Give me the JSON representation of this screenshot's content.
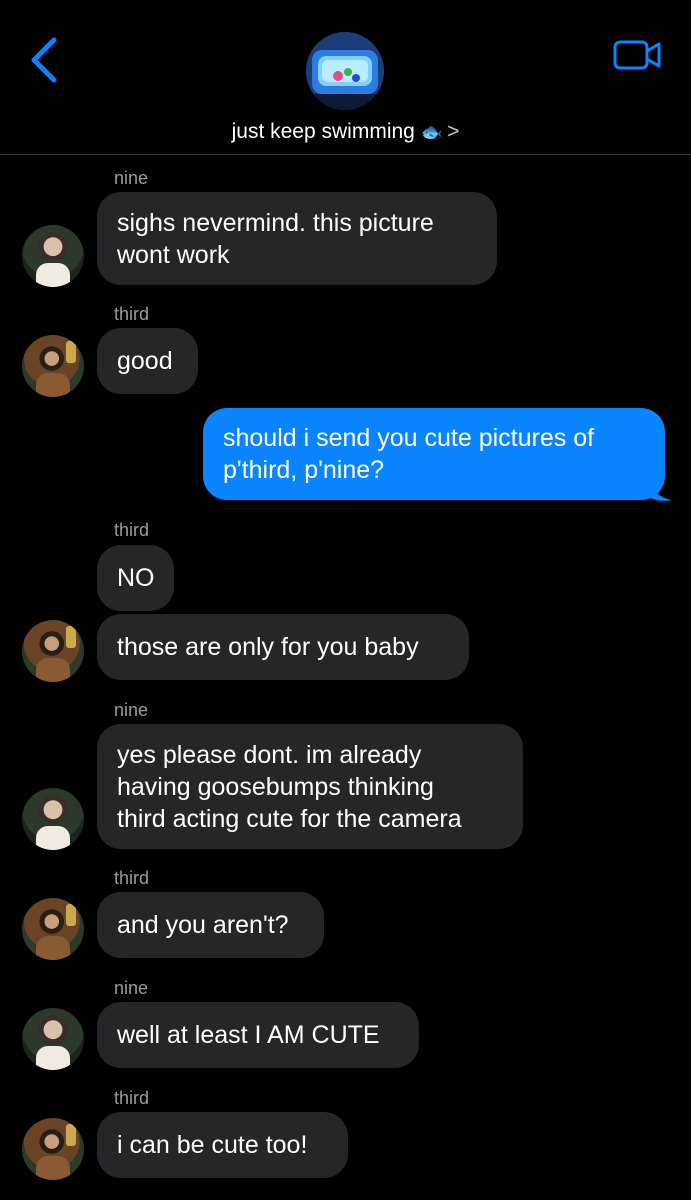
{
  "header": {
    "back_icon": "chevron-left-icon",
    "group_name": "just keep swimming",
    "group_emoji": "🐟",
    "chevron": ">",
    "video_icon": "video-camera-icon"
  },
  "colors": {
    "accent": "#0a84ff",
    "incoming_bubble": "#262628",
    "sender_label": "#9b9ba1",
    "background": "#000000"
  },
  "messages": [
    {
      "sender": "nine",
      "text_lines": [
        "sighs nevermind. this picture",
        "wont work"
      ]
    },
    {
      "sender": "third",
      "text_lines": [
        "good"
      ]
    },
    {
      "sender": "me",
      "text_lines": [
        "should i send you cute pictures of",
        "p'third, p'nine?"
      ]
    },
    {
      "sender": "third",
      "text_lines": [
        "NO"
      ]
    },
    {
      "sender": "",
      "text_lines": [
        "those are only for you baby"
      ]
    },
    {
      "sender": "nine",
      "text_lines": [
        "yes please dont. im already",
        "having goosebumps thinking",
        "third acting cute for the camera"
      ]
    },
    {
      "sender": "third",
      "text_lines": [
        "and you aren't?"
      ]
    },
    {
      "sender": "nine",
      "text_lines": [
        "well at least I AM CUTE"
      ]
    },
    {
      "sender": "third",
      "text_lines": [
        "i can be cute too!"
      ]
    }
  ]
}
